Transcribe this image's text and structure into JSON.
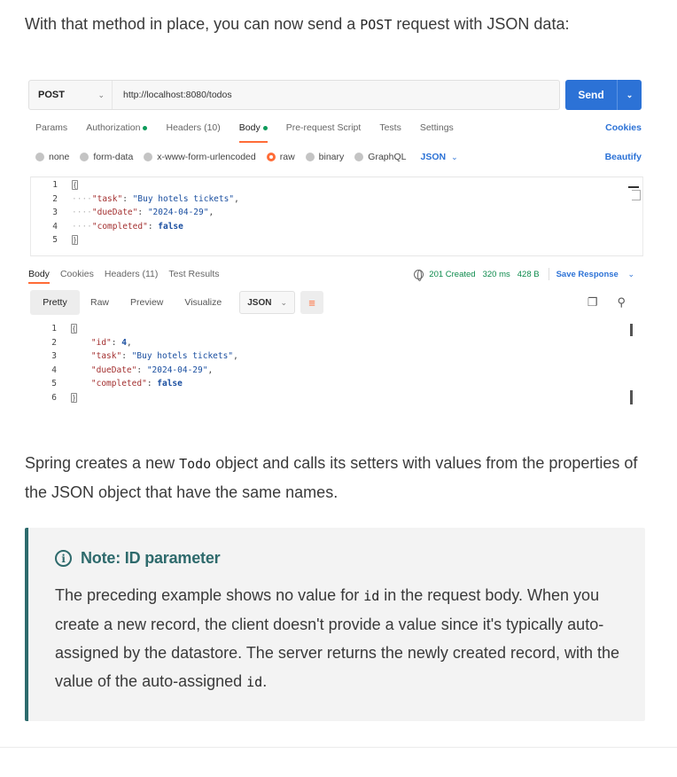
{
  "intro": {
    "before": "With that method in place, you can now send a ",
    "code": "POST",
    "after": " request with JSON data:"
  },
  "postman": {
    "method": "POST",
    "url": "http://localhost:8080/todos",
    "send_label": "Send",
    "request_tabs": [
      {
        "label": "Params",
        "active": false,
        "dot": false
      },
      {
        "label": "Authorization",
        "active": false,
        "dot": true
      },
      {
        "label": "Headers (10)",
        "active": false,
        "dot": false
      },
      {
        "label": "Body",
        "active": true,
        "dot": true
      },
      {
        "label": "Pre-request Script",
        "active": false,
        "dot": false
      },
      {
        "label": "Tests",
        "active": false,
        "dot": false
      },
      {
        "label": "Settings",
        "active": false,
        "dot": false
      }
    ],
    "cookies_label": "Cookies",
    "body_types": [
      "none",
      "form-data",
      "x-www-form-urlencoded",
      "raw",
      "binary",
      "GraphQL"
    ],
    "body_type_selected": "raw",
    "body_format": "JSON",
    "beautify_label": "Beautify",
    "request_body": {
      "lines": [
        "1",
        "2",
        "3",
        "4",
        "5"
      ],
      "task_key": "\"task\"",
      "task_value": "\"Buy hotels tickets\"",
      "dueDate_key": "\"dueDate\"",
      "dueDate_value": "\"2024-04-29\"",
      "completed_key": "\"completed\"",
      "completed_value": "false"
    },
    "response_tabs": [
      {
        "label": "Body",
        "active": true
      },
      {
        "label": "Cookies",
        "active": false
      },
      {
        "label": "Headers (11)",
        "active": false
      },
      {
        "label": "Test Results",
        "active": false
      }
    ],
    "status": "201 Created",
    "time": "320 ms",
    "size": "428 B",
    "save_response_label": "Save Response",
    "view_modes": [
      "Pretty",
      "Raw",
      "Preview",
      "Visualize"
    ],
    "view_mode_selected": "Pretty",
    "response_format": "JSON",
    "response_body": {
      "lines": [
        "1",
        "2",
        "3",
        "4",
        "5",
        "6"
      ],
      "id_key": "\"id\"",
      "id_value": "4",
      "task_key": "\"task\"",
      "task_value": "\"Buy hotels tickets\"",
      "dueDate_key": "\"dueDate\"",
      "dueDate_value": "\"2024-04-29\"",
      "completed_key": "\"completed\"",
      "completed_value": "false"
    }
  },
  "paragraph": {
    "before": "Spring creates a new ",
    "code": "Todo",
    "after": " object and calls its setters with values from the properties of the JSON object that have the same names."
  },
  "note": {
    "title": "Note: ID parameter",
    "before": "The preceding example shows no value for ",
    "code1": "id",
    "middle": " in the request body. When you create a new record, the client doesn't provide a value since it's typically auto-assigned by the datastore. The server returns the newly created record, with the value of the auto-assigned ",
    "code2": "id",
    "after": "."
  },
  "colors": {
    "send_button": "#2c72d6",
    "active_tab_underline": "#ff6c37",
    "status_ok": "#0c8a4c",
    "note_accent": "#2d6b6d"
  }
}
